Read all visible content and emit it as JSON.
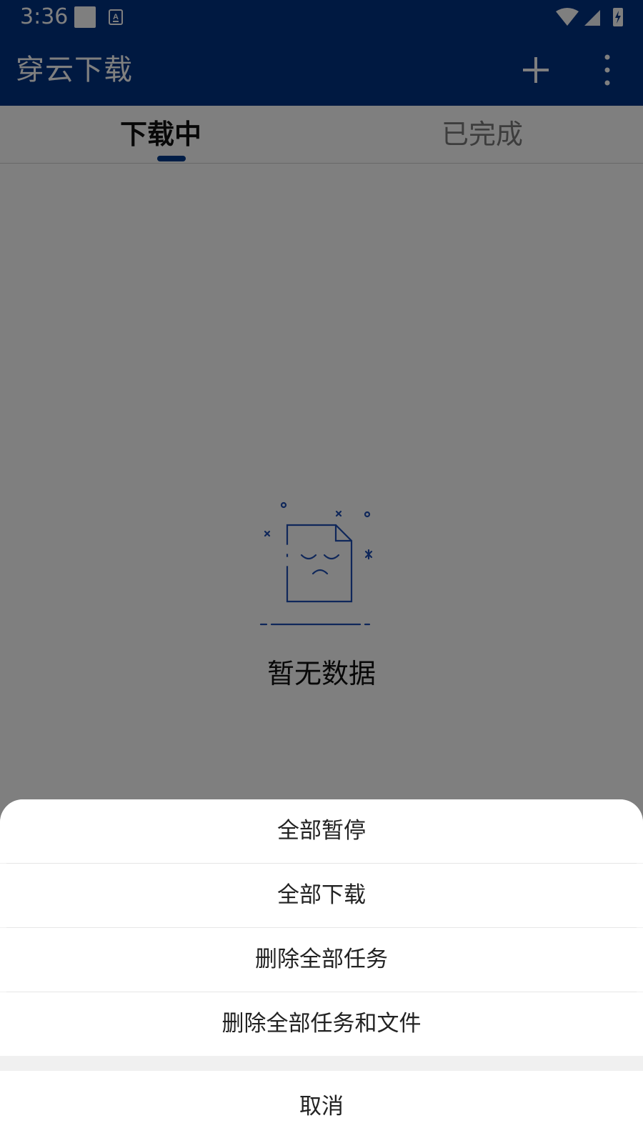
{
  "status_bar": {
    "time": "3:36",
    "icons": [
      "square-notification-icon",
      "keyboard-a-icon",
      "wifi-icon",
      "signal-icon",
      "battery-charging-icon"
    ]
  },
  "app_bar": {
    "title": "穿云下载",
    "color": "#003383",
    "actions": [
      "add-icon",
      "more-vert-icon"
    ]
  },
  "tabs": [
    {
      "label": "下载中",
      "active": true
    },
    {
      "label": "已完成",
      "active": false
    }
  ],
  "empty_state": {
    "icon": "sad-document-icon",
    "text": "暂无数据"
  },
  "bottom_sheet": {
    "items": [
      {
        "label": "全部暂停"
      },
      {
        "label": "全部下载"
      },
      {
        "label": "删除全部任务"
      },
      {
        "label": "删除全部任务和文件"
      }
    ],
    "cancel_label": "取消"
  }
}
